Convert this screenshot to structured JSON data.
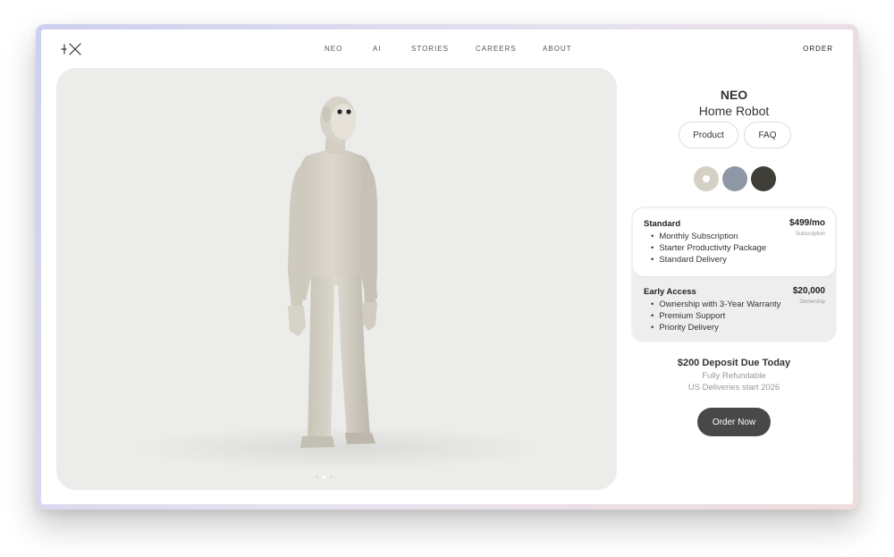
{
  "header": {
    "logo_label": "1X",
    "nav": [
      "NEO",
      "AI",
      "STORIES",
      "CAREERS",
      "ABOUT"
    ],
    "order_label": "ORDER"
  },
  "hero": {
    "image_subject": "humanoid-robot",
    "carousel_count": 3,
    "carousel_active_index": 1
  },
  "product": {
    "name": "NEO",
    "subtitle": "Home Robot",
    "tabs": [
      "Product",
      "FAQ"
    ],
    "colors": [
      "#d5d0c4",
      "#8e97a6",
      "#403e39"
    ],
    "selected_color_index": 0
  },
  "plans": [
    {
      "title": "Standard",
      "price": "$499/mo",
      "price_label": "Subscription",
      "features": [
        "Monthly Subscription",
        "Starter Productivity Package",
        "Standard Delivery"
      ]
    },
    {
      "title": "Early Access",
      "price": "$20,000",
      "price_label": "Ownership",
      "features": [
        "Ownership with 3-Year Warranty",
        "Premium Support",
        "Priority Delivery"
      ]
    }
  ],
  "checkout": {
    "deposit": "$200 Deposit Due Today",
    "refund": "Fully Refundable",
    "delivery": "US Deliveries start 2026",
    "order_button": "Order Now"
  }
}
